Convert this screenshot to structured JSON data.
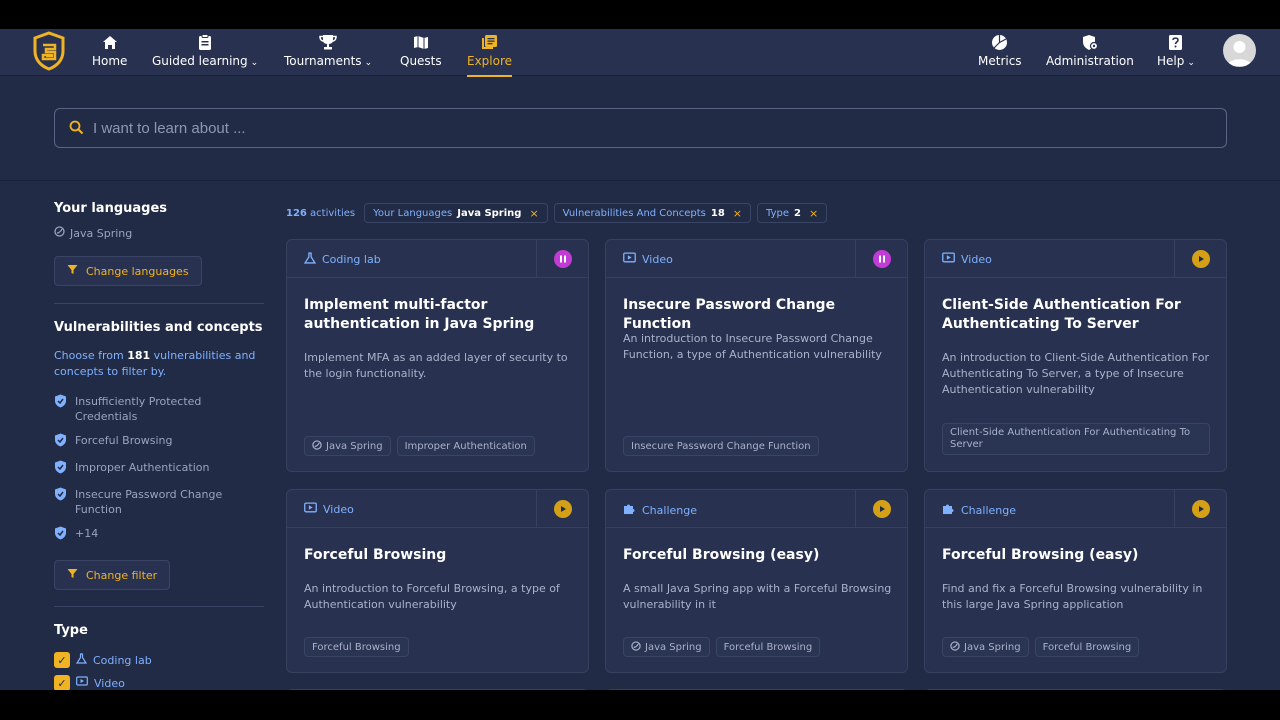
{
  "nav": {
    "items": [
      {
        "label": "Home",
        "icon": "home-icon"
      },
      {
        "label": "Guided learning",
        "icon": "clipboard-icon",
        "dropdown": true
      },
      {
        "label": "Tournaments",
        "icon": "trophy-icon",
        "dropdown": true
      },
      {
        "label": "Quests",
        "icon": "map-icon"
      },
      {
        "label": "Explore",
        "icon": "book-icon",
        "active": true
      }
    ],
    "right": [
      {
        "label": "Metrics",
        "icon": "pie-chart-icon"
      },
      {
        "label": "Administration",
        "icon": "shield-gear-icon"
      },
      {
        "label": "Help",
        "icon": "question-icon",
        "dropdown": true
      }
    ]
  },
  "search": {
    "placeholder": "I want to learn about ..."
  },
  "sidebar": {
    "languages_title": "Your languages",
    "language": "Java Spring",
    "change_languages": "Change languages",
    "vuln_title": "Vulnerabilities and concepts",
    "vuln_desc_pre": "Choose from ",
    "vuln_count": "181",
    "vuln_desc_post": " vulnerabilities and concepts to filter by.",
    "vulns": [
      "Insufficiently Protected Credentials",
      "Forceful Browsing",
      "Improper Authentication",
      "Insecure Password Change Function",
      "+14"
    ],
    "change_filter": "Change filter",
    "type_title": "Type",
    "types": [
      "Coding lab",
      "Video"
    ]
  },
  "chips": {
    "count": "126",
    "count_label": " activities",
    "c1_label": "Your Languages",
    "c1_value": "Java Spring",
    "c2_label": "Vulnerabilities And Concepts",
    "c2_value": "18",
    "c3_label": "Type",
    "c3_value": "2",
    "close": "×"
  },
  "cards": [
    {
      "type": "Coding lab",
      "title": "Implement multi-factor authentication in Java Spring",
      "desc": "Implement MFA as an added layer of security to the login functionality.",
      "tags": [
        "Java Spring",
        "Improper Authentication"
      ],
      "action": "pause"
    },
    {
      "type": "Video",
      "title": "Insecure Password Change Function",
      "desc": "An introduction to Insecure Password Change Function, a type of Authentication vulnerability",
      "tags": [
        "Insecure Password Change Function"
      ],
      "action": "pause"
    },
    {
      "type": "Video",
      "title": "Client-Side Authentication For Authenticating To Server",
      "desc": "An introduction to Client-Side Authentication For Authenticating To Server, a type of Insecure Authentication vulnerability",
      "tags": [
        "Client-Side Authentication For Authenticating To Server"
      ],
      "action": "play"
    },
    {
      "type": "Video",
      "title": "Forceful Browsing",
      "desc": "An introduction to Forceful Browsing, a type of Authentication vulnerability",
      "tags": [
        "Forceful Browsing"
      ],
      "action": "play"
    },
    {
      "type": "Challenge",
      "title": "Forceful Browsing (easy)",
      "desc": "A small Java Spring app with a Forceful Browsing vulnerability in it",
      "tags": [
        "Java Spring",
        "Forceful Browsing"
      ],
      "action": "play"
    },
    {
      "type": "Challenge",
      "title": "Forceful Browsing (easy)",
      "desc": "Find and fix a Forceful Browsing vulnerability in this large Java Spring application",
      "tags": [
        "Java Spring",
        "Forceful Browsing"
      ],
      "action": "play"
    }
  ],
  "colors": {
    "accent": "#f0b323",
    "background": "#222b45",
    "card": "#283250",
    "link": "#7fb1ff",
    "pause": "#c13bd6"
  }
}
